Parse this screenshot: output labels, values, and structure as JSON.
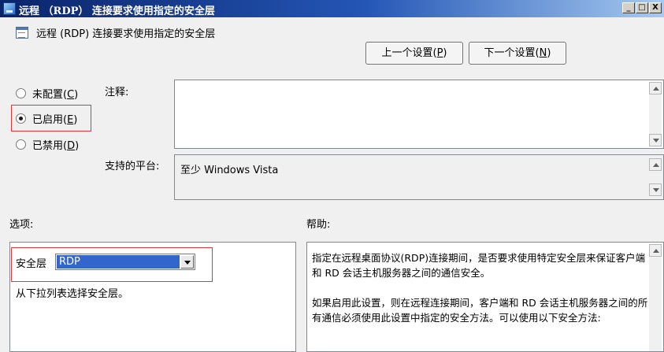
{
  "window": {
    "title": "远程 （RDP） 连接要求使用指定的安全层",
    "minimize": "_",
    "maximize": "□",
    "close": "X"
  },
  "header": {
    "policy_title": "远程 (RDP) 连接要求使用指定的安全层"
  },
  "nav": {
    "prev_text": "上一个设置(",
    "prev_key": "P",
    "prev_end": ")",
    "next_text": "下一个设置(",
    "next_key": "N",
    "next_end": ")"
  },
  "state": {
    "not_configured": {
      "text": "未配置(",
      "key": "C",
      "end": ")"
    },
    "enabled": {
      "text": "已启用(",
      "key": "E",
      "end": ")",
      "selected": true
    },
    "disabled": {
      "text": "已禁用(",
      "key": "D",
      "end": ")"
    }
  },
  "comment": {
    "label": "注释:",
    "value": ""
  },
  "platform": {
    "label": "支持的平台:",
    "value": "至少 Windows Vista"
  },
  "options": {
    "label": "选项:",
    "layer_label": "安全层",
    "layer_value": "RDP",
    "hint": "从下拉列表选择安全层。"
  },
  "help": {
    "label": "帮助:",
    "p1": "指定在远程桌面协议(RDP)连接期间，是否要求使用特定安全层来保证客户端和 RD 会话主机服务器之间的通信安全。",
    "p2": "如果启用此设置，则在远程连接期间，客户端和 RD 会话主机服务器之间的所有通信必须使用此设置中指定的安全方法。可以使用以下安全方法:"
  },
  "colors": {
    "highlight_border": "#e0383a",
    "select_bg": "#3366cc"
  }
}
